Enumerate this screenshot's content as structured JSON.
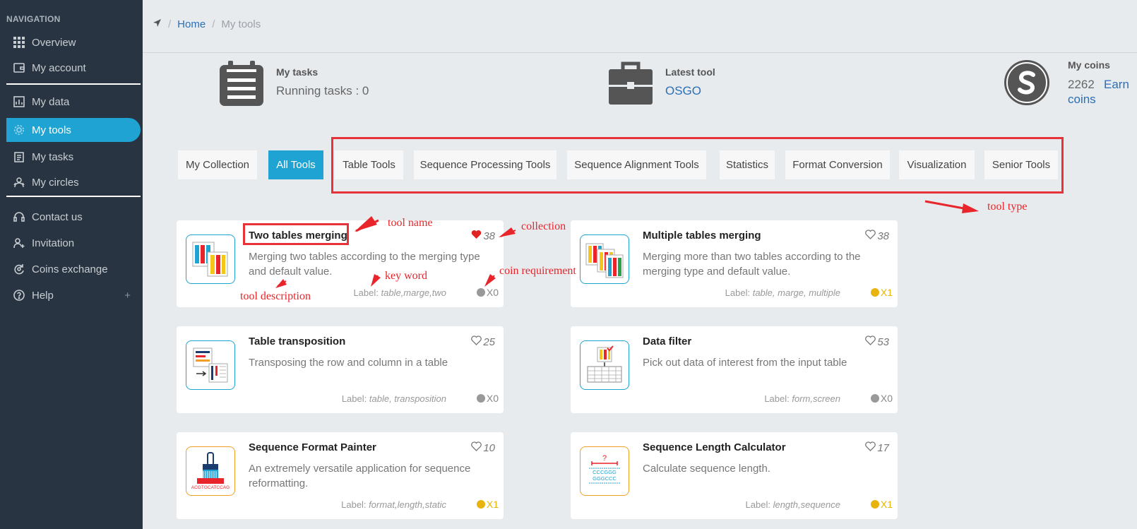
{
  "sidebar": {
    "heading": "NAVIGATION",
    "items": [
      {
        "label": "Overview",
        "icon": "grid-icon"
      },
      {
        "label": "My account",
        "icon": "wallet-icon"
      },
      {
        "label": "My data",
        "icon": "chart-icon"
      },
      {
        "label": "My tools",
        "icon": "gear-icon",
        "active": true
      },
      {
        "label": "My tasks",
        "icon": "clipboard-icon"
      },
      {
        "label": "My circles",
        "icon": "users-icon"
      },
      {
        "label": "Contact us",
        "icon": "headset-icon"
      },
      {
        "label": "Invitation",
        "icon": "user-plus-icon"
      },
      {
        "label": "Coins exchange",
        "icon": "exchange-icon"
      },
      {
        "label": "Help",
        "icon": "question-icon",
        "expand": "+"
      }
    ]
  },
  "breadcrumb": {
    "home": "Home",
    "current": "My tools",
    "sep": "/"
  },
  "stats": {
    "tasks": {
      "title": "My tasks",
      "value": "Running tasks : 0"
    },
    "latest": {
      "title": "Latest tool",
      "value": "OSGO"
    },
    "coins": {
      "title": "My coins",
      "amount": "2262",
      "link_a": "Earn",
      "link_b": "coins"
    }
  },
  "tabs": [
    "My Collection",
    "All Tools",
    "Table Tools",
    "Sequence Processing Tools",
    "Sequence Alignment Tools",
    "Statistics",
    "Format Conversion",
    "Visualization",
    "Senior Tools"
  ],
  "label_prefix": "Label:",
  "tools": [
    {
      "title": "Two tables merging",
      "likes": "38",
      "liked": true,
      "desc": "Merging two tables according to the merging type and default value.",
      "labels": "table,marge,two",
      "coin": "X0"
    },
    {
      "title": "Multiple tables merging",
      "likes": "38",
      "liked": false,
      "desc": "Merging more than two tables according to the merging type and default value.",
      "labels": "table, marge, multiple",
      "coin": "X1"
    },
    {
      "title": "Table transposition",
      "likes": "25",
      "liked": false,
      "desc": "Transposing the row and column in a table",
      "labels": "table, transposition",
      "coin": "X0"
    },
    {
      "title": "Data filter",
      "likes": "53",
      "liked": false,
      "desc": "Pick out data of interest from the input table",
      "labels": "form,screen",
      "coin": "X0"
    },
    {
      "title": "Sequence Format Painter",
      "likes": "10",
      "liked": false,
      "desc": "An extremely versatile application for sequence reformatting.",
      "labels": "format,length,static",
      "coin": "X1"
    },
    {
      "title": "Sequence Length Calculator",
      "likes": "17",
      "liked": false,
      "desc": "Calculate sequence length.",
      "labels": "length,sequence",
      "coin": "X1"
    }
  ],
  "annotations": {
    "tool_name": "tool name",
    "collection": "collection",
    "key_word": "key word",
    "coin_requirement": "coin requirement",
    "tool_description": "tool description",
    "tool_type": "tool type"
  },
  "thumb_text": {
    "painter": "ACGTGCATCCAG",
    "calc_q": "?",
    "calc_a": "CCCGGG",
    "calc_b": "GGGCCC"
  },
  "colors": {
    "accent": "#1fa3d3",
    "sidebar": "#283441",
    "link": "#2a6fb8",
    "annotation": "#e8252a",
    "coin_gold": "#e8b30c",
    "heart": "#e02424"
  }
}
